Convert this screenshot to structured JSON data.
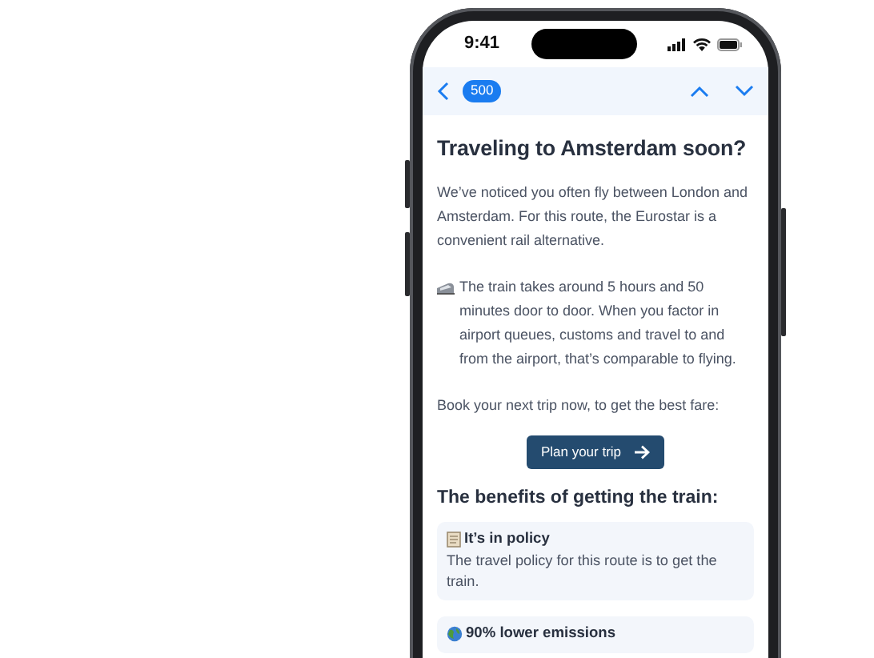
{
  "status_bar": {
    "time": "9:41"
  },
  "nav": {
    "badge": "500"
  },
  "email": {
    "title": "Traveling to Amsterdam soon?",
    "paragraphs": [
      {
        "text": "We’ve noticed you often fly between London and Amsterdam. For this route, the Eurostar is a convenient rail alternative."
      },
      {
        "kind": "train",
        "text": "The train takes around 5 hours and 50 minutes door to door. When you factor in airport queues, customs and travel to and from the airport, that’s comparable to flying."
      },
      {
        "text": "Book your next trip now, to get the best fare:"
      }
    ],
    "button": "Plan your trip",
    "benefits_title": "The benefits of getting the train:",
    "benefits": [
      {
        "kind": "document",
        "title": "It’s in policy",
        "text": "The travel policy for this route is to get the train."
      },
      {
        "kind": "globe",
        "title": "90% lower emissions"
      }
    ]
  }
}
